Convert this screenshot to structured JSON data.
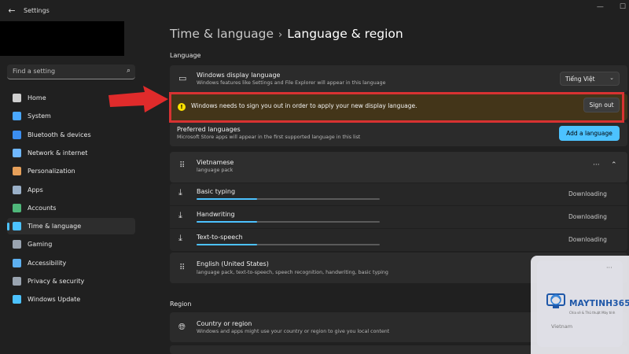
{
  "window": {
    "title": "Settings",
    "back_icon": "back-arrow-icon"
  },
  "sidebar": {
    "search_placeholder": "Find a setting",
    "items": [
      {
        "label": "Home",
        "icon": "home-icon",
        "color": "#cfcfcf",
        "active": false
      },
      {
        "label": "System",
        "icon": "system-icon",
        "color": "#4aa8ff",
        "active": false
      },
      {
        "label": "Bluetooth & devices",
        "icon": "bluetooth-icon",
        "color": "#3b8ef0",
        "active": false
      },
      {
        "label": "Network & internet",
        "icon": "wifi-icon",
        "color": "#6fb7ff",
        "active": false
      },
      {
        "label": "Personalization",
        "icon": "brush-icon",
        "color": "#e6a05a",
        "active": false
      },
      {
        "label": "Apps",
        "icon": "apps-icon",
        "color": "#9ab0c8",
        "active": false
      },
      {
        "label": "Accounts",
        "icon": "accounts-icon",
        "color": "#4fb77a",
        "active": false
      },
      {
        "label": "Time & language",
        "icon": "globe-clock-icon",
        "color": "#4cc2ff",
        "active": true
      },
      {
        "label": "Gaming",
        "icon": "gaming-icon",
        "color": "#9aa4b0",
        "active": false
      },
      {
        "label": "Accessibility",
        "icon": "accessibility-icon",
        "color": "#5db0f0",
        "active": false
      },
      {
        "label": "Privacy & security",
        "icon": "shield-icon",
        "color": "#9aa4b0",
        "active": false
      },
      {
        "label": "Windows Update",
        "icon": "update-icon",
        "color": "#4cc2ff",
        "active": false
      }
    ]
  },
  "header": {
    "parent": "Time & language",
    "current": "Language & region"
  },
  "language_section": {
    "header": "Language",
    "display_language": {
      "title": "Windows display language",
      "subtitle": "Windows features like Settings and File Explorer will appear in this language",
      "value": "Tiếng Việt"
    },
    "notice": {
      "text": "Windows needs to sign you out in order to apply your new display language.",
      "button": "Sign out"
    },
    "preferred": {
      "title": "Preferred languages",
      "subtitle": "Microsoft Store apps will appear in the first supported language in this list",
      "button": "Add a language"
    },
    "languages": [
      {
        "name": "Vietnamese",
        "detail": "language pack",
        "features": [
          {
            "name": "Basic typing",
            "status": "Downloading",
            "progress": 0.33
          },
          {
            "name": "Handwriting",
            "status": "Downloading",
            "progress": 0.33
          },
          {
            "name": "Text-to-speech",
            "status": "Downloading",
            "progress": 0.33
          }
        ]
      },
      {
        "name": "English (United States)",
        "detail": "language pack, text-to-speech, speech recognition, handwriting, basic typing"
      }
    ]
  },
  "region_section": {
    "header": "Region",
    "country": {
      "title": "Country or region",
      "subtitle": "Windows and apps might use your country or region to give you local content"
    }
  },
  "watermark": {
    "brand": "MAYTINH365",
    "tagline": "Chia sẻ & Thủ thuật Máy tính",
    "region_value": "Vietnam"
  },
  "colors": {
    "accent": "#4cc2ff",
    "warning_bg": "#433519",
    "highlight": "#d83232"
  }
}
